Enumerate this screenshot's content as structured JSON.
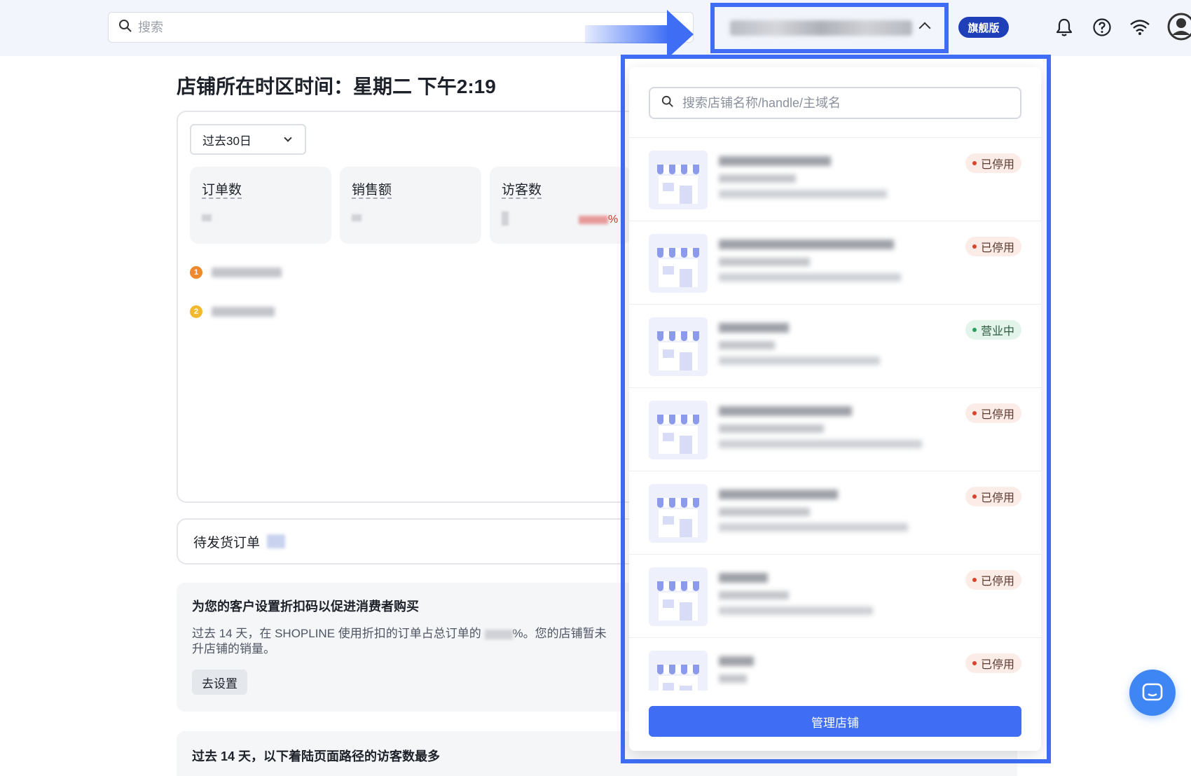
{
  "header": {
    "search_placeholder": "搜索",
    "plan_badge": "旗舰版",
    "icons": [
      "bell-icon",
      "help-icon",
      "wifi-icon",
      "avatar-icon"
    ]
  },
  "main": {
    "title": "店铺所在时区时间：星期二 下午2:19",
    "range_label": "过去30日",
    "metrics": [
      {
        "label": "订单数"
      },
      {
        "label": "销售额"
      },
      {
        "label": "访客数",
        "suffix": "%"
      }
    ],
    "ranks": [
      "1",
      "2"
    ],
    "pending_label": "待发货订单",
    "promo": {
      "title": "为您的客户设置折扣码以促进消费者购买",
      "text_a": "过去 14 天，在 SHOPLINE 使用折扣的订单占总订单的",
      "text_b": "%。您的店铺暂未",
      "text_c": "升店铺的销量。",
      "button": "去设置"
    },
    "landing_title": "过去 14 天，以下着陆页面路径的访客数最多"
  },
  "store_panel": {
    "search_placeholder": "搜索店铺名称/handle/主域名",
    "stores": [
      {
        "status": "已停用"
      },
      {
        "status": "已停用"
      },
      {
        "status": "营业中"
      },
      {
        "status": "已停用"
      },
      {
        "status": "已停用"
      },
      {
        "status": "已停用"
      },
      {
        "status": "已停用"
      }
    ],
    "manage_button": "管理店铺"
  },
  "colors": {
    "accent": "#3f6ef5",
    "badge": "#1e3fb8",
    "status_off": "#d8452c",
    "status_on": "#2e9c5d"
  }
}
